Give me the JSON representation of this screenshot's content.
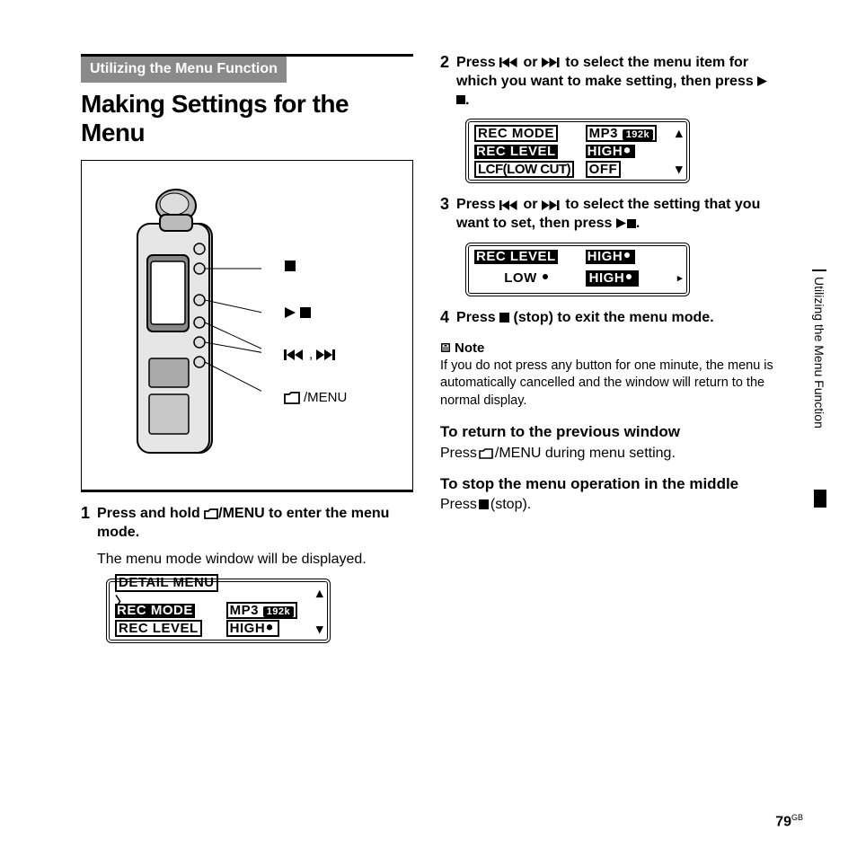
{
  "section_label": "Utilizing the Menu Function",
  "heading": "Making Settings for the Menu",
  "diagram": {
    "callout1": "■",
    "callout2": "▶■",
    "callout3_prefix": "",
    "callout3_suffix": "",
    "callout4": "/MENU"
  },
  "steps": {
    "s1": {
      "num": "1",
      "bold_a": "Press and hold ",
      "bold_b": "/MENU to enter the menu mode.",
      "plain": "The menu mode window will be displayed."
    },
    "s2": {
      "num": "2",
      "bold_a": "Press ",
      "bold_b": " or ",
      "bold_c": " to select the menu item for which you want to make setting, then press ",
      "bold_d": "."
    },
    "s3": {
      "num": "3",
      "bold_a": "Press ",
      "bold_b": " or ",
      "bold_c": " to select the setting that you want to set, then press ",
      "bold_d": "."
    },
    "s4": {
      "num": "4",
      "bold_a": "Press ",
      "bold_b": " (stop) to exit the menu mode."
    }
  },
  "lcd1": {
    "r1l": "DETAIL MENU",
    "r1r": "",
    "r2l": "REC MODE",
    "r2r": "MP3",
    "r2badge": "192k",
    "r3l": "REC LEVEL",
    "r3r": "HIGH"
  },
  "lcd2": {
    "r1l": "REC MODE",
    "r1r": "MP3",
    "r1badge": "192k",
    "r2l": "REC LEVEL",
    "r2r": "HIGH",
    "r3l": "LCF(LOW CUT)",
    "r3r": "OFF"
  },
  "lcd3": {
    "r1l": "REC LEVEL",
    "r1r": "HIGH",
    "r2l": "LOW",
    "r2r": "HIGH"
  },
  "note": {
    "hd": "Note",
    "body": "If you do not press any button for one minute, the menu is automatically cancelled and the window will return to the normal display."
  },
  "return": {
    "hd": "To return to the previous window",
    "pre": "Press ",
    "post": "/MENU during menu setting."
  },
  "stop": {
    "hd": "To stop the menu operation in the middle",
    "pre": "Press ",
    "post": " (stop)."
  },
  "side_tab": "Utilizing the Menu Function",
  "page_num": "79",
  "page_suffix": "GB"
}
